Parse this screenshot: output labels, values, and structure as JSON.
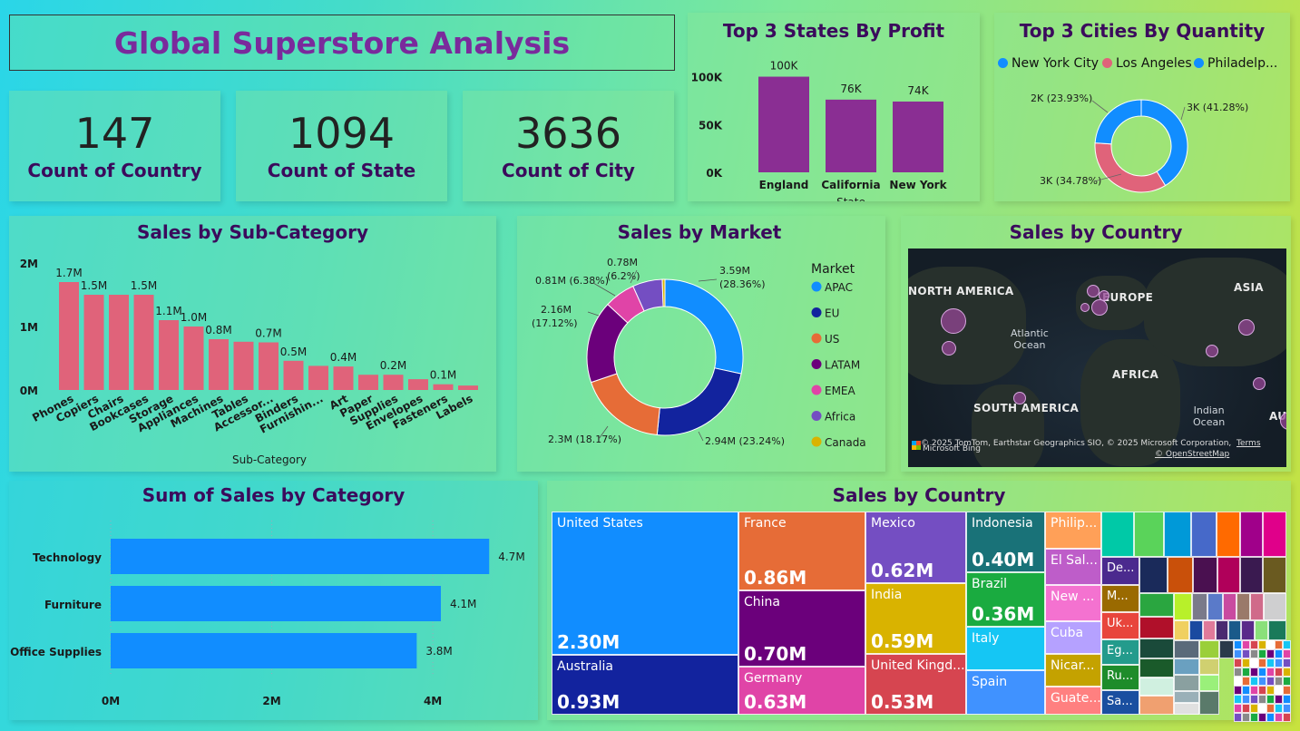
{
  "title": "Global Superstore Analysis",
  "kpis": [
    {
      "value": "147",
      "label": "Count of Country"
    },
    {
      "value": "1094",
      "label": "Count of State"
    },
    {
      "value": "3636",
      "label": "Count of City"
    }
  ],
  "top_states": {
    "title": "Top 3 States By Profit",
    "xlabel": "State",
    "yticks": [
      "100K",
      "50K",
      "0K"
    ],
    "ylim": [
      0,
      110000
    ]
  },
  "top_cities": {
    "title": "Top 3 Cities By Quantity",
    "legend": [
      "New York City",
      "Los Angeles",
      "Philadelp..."
    ],
    "labels": [
      "3K (41.28%)",
      "3K (34.78%)",
      "2K (23.93%)"
    ]
  },
  "subcat": {
    "title": "Sales by Sub-Category",
    "xlabel": "Sub-Category",
    "yticks": [
      "2M",
      "1M",
      "0M"
    ]
  },
  "market": {
    "title": "Sales by Market",
    "legend_title": "Market",
    "labels": [
      "3.59M",
      "(28.36%)",
      "2.94M (23.24%)",
      "2.3M (18.17%)",
      "2.16M",
      "(17.12%)",
      "0.81M (6.38%)",
      "0.78M",
      "(6.2%)"
    ]
  },
  "map": {
    "title": "Sales by Country",
    "labels": [
      "NORTH AMERICA",
      "EUROPE",
      "ASIA",
      "AFRICA",
      "SOUTH AMERICA",
      "AUS"
    ],
    "oceans": [
      "Atlantic",
      "Ocean",
      "Indian",
      "Ocean"
    ],
    "copyright": "© 2025 TomTom, Earthstar Geographics SIO, © 2025 Microsoft Corporation,",
    "terms": "Terms",
    "osm": "© OpenStreetMap",
    "brand": "Microsoft Bing"
  },
  "category": {
    "title": "Sum of Sales by Category",
    "xticks": [
      "0M",
      "2M",
      "4M"
    ]
  },
  "treemap": {
    "title": "Sales by Country",
    "cells": [
      {
        "name": "United States",
        "value": "2.30M",
        "color": "#118dff"
      },
      {
        "name": "Australia",
        "value": "0.93M",
        "color": "#12239e"
      },
      {
        "name": "France",
        "value": "0.86M",
        "color": "#e66c37"
      },
      {
        "name": "China",
        "value": "0.70M",
        "color": "#6b007b"
      },
      {
        "name": "Germany",
        "value": "0.63M",
        "color": "#e044a7"
      },
      {
        "name": "Mexico",
        "value": "0.62M",
        "color": "#744ec2"
      },
      {
        "name": "India",
        "value": "0.59M",
        "color": "#d9b300"
      },
      {
        "name": "United Kingd...",
        "value": "0.53M",
        "color": "#d64550"
      },
      {
        "name": "Indonesia",
        "value": "0.40M",
        "color": "#197278"
      },
      {
        "name": "Brazil",
        "value": "0.36M",
        "color": "#1aab40"
      },
      {
        "name": "Italy",
        "value": "",
        "color": "#15c6f4"
      },
      {
        "name": "Spain",
        "value": "",
        "color": "#4092ff"
      },
      {
        "name": "Philip...",
        "value": "",
        "color": "#ffa058"
      },
      {
        "name": "El Sal...",
        "value": "",
        "color": "#be5dc9"
      },
      {
        "name": "New ...",
        "value": "",
        "color": "#f472d0"
      },
      {
        "name": "Cuba",
        "value": "",
        "color": "#b5a1ff"
      },
      {
        "name": "Nicar...",
        "value": "",
        "color": "#c4a200"
      },
      {
        "name": "Guate...",
        "value": "",
        "color": "#ff8080"
      },
      {
        "name": "De...",
        "value": "",
        "color": "#4b2a8e"
      },
      {
        "name": "M...",
        "value": "",
        "color": "#9a6a00"
      },
      {
        "name": "Uk...",
        "value": "",
        "color": "#e8453c"
      },
      {
        "name": "Eg...",
        "value": "",
        "color": "#239b8c"
      },
      {
        "name": "Ru...",
        "value": "",
        "color": "#1e8c2a"
      },
      {
        "name": "Sa...",
        "value": "",
        "color": "#1a4fa0"
      }
    ]
  },
  "chart_data": [
    {
      "type": "bar",
      "title": "Top 3 States By Profit",
      "categories": [
        "England",
        "California",
        "New York"
      ],
      "values": [
        100000,
        76000,
        74000
      ],
      "data_labels": [
        "100K",
        "76K",
        "74K"
      ],
      "xlabel": "State",
      "ylim": [
        0,
        110000
      ],
      "color": "#8a2e93"
    },
    {
      "type": "pie",
      "title": "Top 3 Cities By Quantity",
      "categories": [
        "New York City",
        "Los Angeles",
        "Philadelp..."
      ],
      "values": [
        41.28,
        34.78,
        23.93
      ],
      "colors": [
        "#118dff",
        "#e0637a",
        "#118dff"
      ]
    },
    {
      "type": "bar",
      "title": "Sales by Sub-Category",
      "categories": [
        "Phones",
        "Copiers",
        "Chairs",
        "Bookcases",
        "Storage",
        "Appliances",
        "Machines",
        "Tables",
        "Accessor...",
        "Binders",
        "Furnishin...",
        "Art",
        "Paper",
        "Supplies",
        "Envelopes",
        "Fasteners",
        "Labels"
      ],
      "values": [
        1.7,
        1.5,
        1.5,
        1.5,
        1.1,
        1.0,
        0.8,
        0.76,
        0.75,
        0.46,
        0.38,
        0.37,
        0.24,
        0.24,
        0.17,
        0.09,
        0.07
      ],
      "data_labels": [
        "1.7M",
        "1.5M",
        "",
        "1.5M",
        "1.1M",
        "1.0M",
        "0.8M",
        "",
        "0.7M",
        "0.5M",
        "",
        "0.4M",
        "",
        "0.2M",
        "",
        "0.1M",
        ""
      ],
      "xlabel": "Sub-Category",
      "ylim": [
        0,
        2
      ],
      "color": "#e0637a"
    },
    {
      "type": "pie",
      "title": "Sales by Market",
      "categories": [
        "APAC",
        "EU",
        "US",
        "LATAM",
        "EMEA",
        "Africa",
        "Canada"
      ],
      "values": [
        3.59,
        2.94,
        2.3,
        2.16,
        0.81,
        0.78,
        0.07
      ],
      "colors": [
        "#118dff",
        "#12239e",
        "#e66c37",
        "#6b007b",
        "#e044a7",
        "#744ec2",
        "#d9b300"
      ]
    },
    {
      "type": "bar",
      "title": "Sum of Sales by Category",
      "categories": [
        "Technology",
        "Furniture",
        "Office Supplies"
      ],
      "values": [
        4.7,
        4.1,
        3.8
      ],
      "data_labels": [
        "4.7M",
        "4.1M",
        "3.8M"
      ],
      "xlim": [
        0,
        4.9
      ],
      "color": "#118dff"
    }
  ]
}
